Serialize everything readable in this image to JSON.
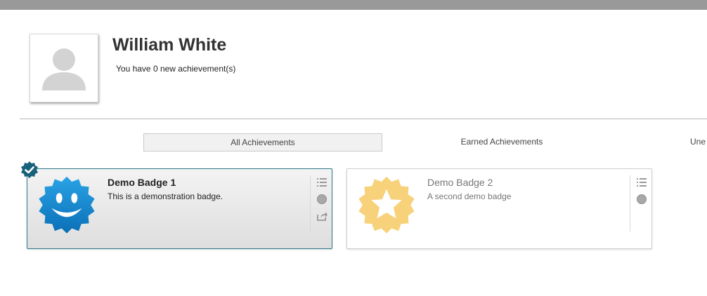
{
  "colors": {
    "accent": "#17617a",
    "blue_badge": "#1a87d0",
    "gold_badge": "#f7d27a"
  },
  "user": {
    "name": "William White",
    "subtitle": "You have 0 new achievement(s)"
  },
  "tabs": [
    {
      "label": "All Achievements",
      "active": true
    },
    {
      "label": "Earned Achievements",
      "active": false
    },
    {
      "label": "Une",
      "active": false
    }
  ],
  "badges": [
    {
      "title": "Demo Badge 1",
      "description": "This is a demonstration badge.",
      "earned": true,
      "icon": "smiley-badge-icon",
      "actions": [
        "list-icon",
        "circle-icon",
        "share-icon"
      ]
    },
    {
      "title": "Demo Badge 2",
      "description": "A second demo badge",
      "earned": false,
      "icon": "star-badge-icon",
      "actions": [
        "list-icon",
        "circle-icon"
      ]
    }
  ]
}
